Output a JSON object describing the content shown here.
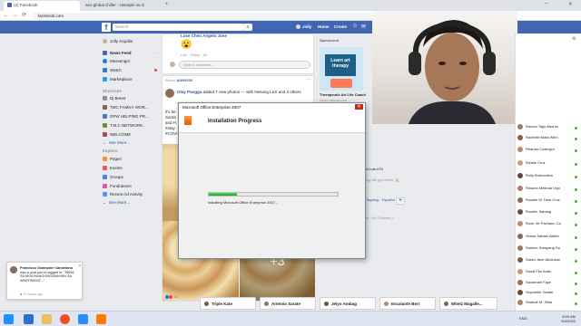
{
  "browser": {
    "tabs": [
      {
        "label": "(2) Facebook",
        "active": true
      },
      {
        "label": "ano global chiller - Hanapin sa G",
        "active": false
      }
    ],
    "url": "facebook.com"
  },
  "fb_header": {
    "search_placeholder": "Search",
    "user_name": "Jolly",
    "home_label": "Home",
    "create_label": "Create"
  },
  "left_nav": {
    "profile": "Jolly Arquilla",
    "items": [
      "News Feed",
      "Messenger",
      "Watch",
      "Marketplace"
    ],
    "shortcuts_heading": "Shortcuts",
    "shortcuts": [
      "Dj Beeet",
      "TMC FAMILY WOR...",
      "OFW HELPING PR...",
      "T.M.C NETWORK...",
      "WELCOME"
    ],
    "see_more": "See More...",
    "explore_heading": "Explore",
    "explore": [
      "Pages",
      "Events",
      "Groups",
      "Fundraisers",
      "Recent Ad Activity"
    ],
    "see_more2": "See More..."
  },
  "feed": {
    "comment_author": "Lose Chen Angelo Jose",
    "comment_actions": "Like · Reply · 6h",
    "write_comment": "Write a comment...",
    "album_label": "Album",
    "album_name": "AUH2020",
    "post_author": "Olay Pangga",
    "post_action": "added 7 new photos — with Nesang Lezl and 4 others",
    "post_meta": "at United Arab Emirates",
    "post_snippet": [
      "it's be",
      "Santa",
      "and H",
      "#stay",
      "#COVI"
    ],
    "photo_more": "+3",
    "reactions_count": "10"
  },
  "right_col": {
    "sponsored_heading": "Sponsored",
    "ad_title": "Learn art therapy",
    "ad_name": "Therapeutic Art Life Coach",
    "ad_url": "www.udemy.com",
    "promo_code": "rCode:#75",
    "promo_text": "ing will get better. 🙏",
    "lang_text": "Tagalog · Español",
    "lang_more": "...",
    "footer": "nt · Ad Choices ▷"
  },
  "chat": {
    "contacts": [
      "Racma Tago Abores",
      "Rachelle Mata Wilm",
      "Rhanan Cuaingco",
      "Rizalie Cruz",
      "Rolly Buencolina",
      "Rosario Melinda Vigo",
      "Rosalie M. Dela Cruz",
      "Roselin Sabang",
      "Rose Jie Pachano Ca",
      "Selma Sabian Akilah",
      "Salome Sampang Sa",
      "Sarah Jane Abulusan",
      "Saudi Flor Avila",
      "Savannah Faye",
      "Seychelle Tadafe",
      "Shahdir M. Shila"
    ],
    "search_label": "Search"
  },
  "chat_tabs": [
    "Triple Kate",
    "Artemio Sarate",
    "Jelyn Ambag",
    "Escalante Bert",
    "Whelz Magalle..."
  ],
  "notification": {
    "name": "Francisco Ocampine Candelaria",
    "text": "was a post you're tagged in: \"PARA SA MGA NANGUNGUNAHAN SA APARTMENT...\"",
    "time": "10 hours ago"
  },
  "dialog": {
    "window_title": "Microsoft Office Enterprise 2007",
    "heading": "Installation Progress",
    "status": "Installing Microsoft Office Enterprise 2007...",
    "progress": 0.22
  },
  "taskbar": {
    "time": "8:09 AM",
    "date": "5/4/2020",
    "lang": "ENG"
  },
  "colors": {
    "fb_blue": "#4267b2",
    "progress_green": "#06b025",
    "online_green": "#42b72a"
  }
}
